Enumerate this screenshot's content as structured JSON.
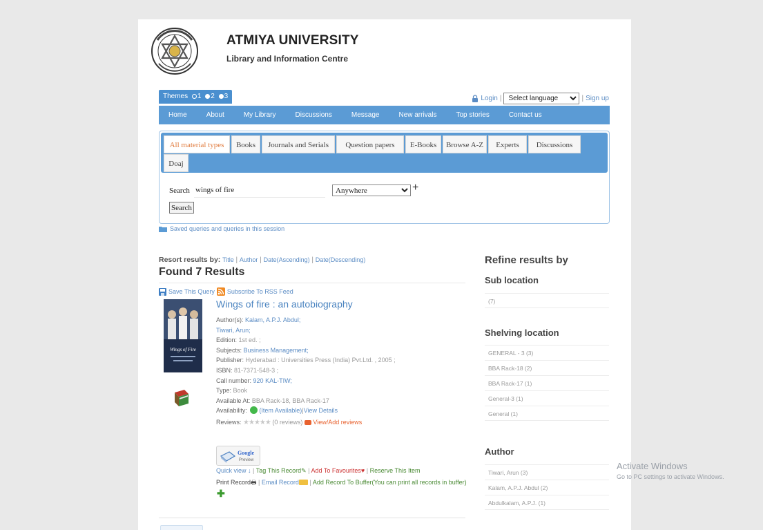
{
  "header": {
    "university": "ATMIYA UNIVERSITY",
    "subtitle": "Library and Information Centre",
    "themes_label": "Themes",
    "theme_options": [
      "1",
      "2",
      "3"
    ],
    "login": "Login",
    "language_select": "Select language",
    "signup": "Sign up"
  },
  "nav": {
    "items": [
      "Home",
      "About",
      "My Library",
      "Discussions",
      "Message",
      "New arrivals",
      "Top stories",
      "Contact us"
    ]
  },
  "search_tabs": [
    "All material types",
    "Books",
    "Journals and Serials",
    "Question papers",
    "E-Books",
    "Browse A-Z",
    "Experts",
    "Discussions",
    "Doaj"
  ],
  "search": {
    "label": "Search",
    "value": "wings of fire",
    "scope": "Anywhere",
    "button": "Search",
    "saved": "Saved queries and queries in this session"
  },
  "results": {
    "resort_label": "Resort results by:",
    "resort_options": [
      "Title",
      "Author",
      "Date(Ascending)",
      "Date(Descending)"
    ],
    "found": "Found 7 Results",
    "save_query": "Save This Query",
    "subscribe": "Subscribe To RSS Feed",
    "title": "Wings of fire : an autobiography",
    "authors_label": "Author(s):",
    "author1": "Kalam, A.P.J. Abdul;",
    "author2": "Tiwari, Arun;",
    "edition_label": "Edition:",
    "edition": "1st ed. ;",
    "subjects_label": "Subjects:",
    "subjects": "Business Management;",
    "publisher_label": "Publisher:",
    "publisher": "Hyderabad : Universities Press (India) Pvt.Ltd. , 2005 ;",
    "isbn_label": "ISBN:",
    "isbn": "81-7371-548-3 ;",
    "call_label": "Call number:",
    "call": "920 KAL-TIW;",
    "type_label": "Type:",
    "type": "Book",
    "available_label": "Available At:",
    "available": "BBA Rack-18, BBA Rack-17",
    "availability_label": "Availability:",
    "availability": "(Item Available)",
    "view_details": "View Details",
    "reviews_label": "Reviews:",
    "stars": "★★★★★",
    "reviews_count": "(0 reviews)",
    "view_add_reviews": "View/Add reviews",
    "google_preview": "Google Preview",
    "quick_view": "Quick view",
    "tag_record": "Tag This Record",
    "add_fav": "Add To Favourites",
    "reserve": "Reserve This Item",
    "print_record": "Print Record",
    "email_record": "Email Record",
    "add_buffer": "Add Record To Buffer(You can print all records in buffer)"
  },
  "refine": {
    "title": "Refine results by",
    "sub_location": {
      "heading": "Sub location",
      "items": [
        "(7)"
      ]
    },
    "shelving": {
      "heading": "Shelving location",
      "items": [
        "GENERAL - 3 (3)",
        "BBA Rack-18 (2)",
        "BBA Rack-17 (1)",
        "General-3 (1)",
        "General (1)"
      ]
    },
    "author": {
      "heading": "Author",
      "items": [
        "Tiwari, Arun (3)",
        "Kalam, A.P.J. Abdul (2)",
        "Abdulkalam, A.P.J. (1)"
      ]
    }
  },
  "watermark": {
    "line1": "Activate Windows",
    "line2": "Go to PC settings to activate Windows."
  }
}
